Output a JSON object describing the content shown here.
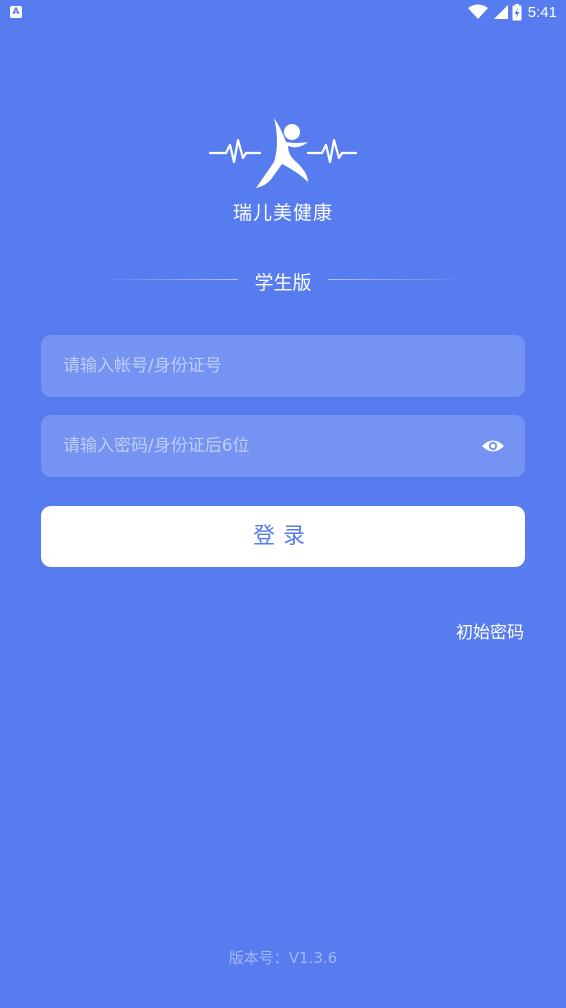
{
  "status_bar": {
    "notification_icon": "A",
    "time": "5:41",
    "icons": [
      "wifi-icon",
      "cellular-signal-icon",
      "battery-icon"
    ]
  },
  "app": {
    "name": "瑞儿美健康",
    "edition": "学生版"
  },
  "form": {
    "account_placeholder": "请输入帐号/身份证号",
    "account_value": "",
    "password_placeholder": "请输入密码/身份证后6位",
    "password_value": "",
    "login_label": "登录",
    "initial_password_label": "初始密码"
  },
  "footer": {
    "version": "版本号：V1.3.6"
  },
  "colors": {
    "background": "#567cef",
    "button_text": "#567cef",
    "button_background": "#ffffff"
  }
}
